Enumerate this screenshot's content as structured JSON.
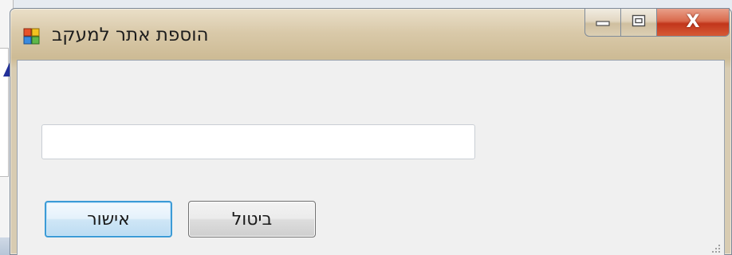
{
  "window": {
    "title": "הוספת אתר למעקב",
    "icon": "app-window-icon"
  },
  "caption_buttons": {
    "minimize_icon": "minimize-icon",
    "maximize_icon": "maximize-icon",
    "close_glyph": "X"
  },
  "form": {
    "url_input": {
      "value": "",
      "placeholder": ""
    },
    "ok_label": "אישור",
    "cancel_label": "ביטול"
  },
  "colors": {
    "titlebar": "#d9c9a9",
    "close_button": "#c2361b",
    "default_button_border": "#3c9bd6",
    "client_background": "#f0f0f0"
  }
}
